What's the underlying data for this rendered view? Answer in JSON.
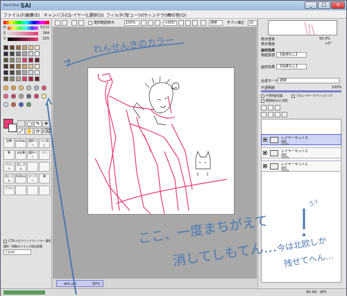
{
  "titlebar": {
    "logo_small": "PaintTool",
    "logo_main": "SAI",
    "minimize": "_",
    "maximize": "□",
    "close": "×"
  },
  "menu": [
    "ファイル(F)",
    "編集(E)",
    "キャンバス(C)",
    "レイヤー(L)",
    "選択(S)",
    "フィルタ(T)",
    "ビュー(V)",
    "ウィンドウ(W)",
    "その他(O)"
  ],
  "toolbar": {
    "selection_outline": "選択範囲表示",
    "zoom": "100%",
    "rotation": "+000°",
    "blend": "通常",
    "stabilizer_label": "手ブレ補正",
    "stabilizer_value": "10"
  },
  "color_sliders": [
    {
      "label": "H",
      "value": "5172"
    },
    {
      "label": "S",
      "value": "164"
    },
    {
      "label": "V",
      "value": "255"
    }
  ],
  "tools": {
    "brush_rows": [
      [
        "鉛筆",
        "vektaple",
        "選択ペン",
        "ペン消し"
      ],
      [
        "筆",
        "水彩筆",
        "選択ペン",
        "ペン"
      ],
      [
        "パラレル",
        "消しゴム",
        "",
        ""
      ],
      [
        "消しゴム",
        "AirBrush",
        "マーカー",
        "筆"
      ],
      [
        "ブラシ",
        "",
        "",
        ""
      ]
    ],
    "ctrl_checkbox": "CTRL+左クリックでレイヤー選択",
    "drag_threshold": "選択・移動のドラッグ検出距離",
    "brush_size": "1 pixel"
  },
  "navigator": {
    "zoom": "50.0%",
    "angle": "+0°"
  },
  "panel": {
    "zoom_label": "表示倍率",
    "angle_label": "表示角度",
    "effect_header": "画材効果",
    "texture_label": "用紙質感",
    "texture_value": "【質感なし】",
    "effect_label": "画材効果",
    "effect_value": "【効果なし】",
    "blend_label": "合成モード",
    "blend_value": "通常",
    "opacity_label": "不透明度",
    "opacity_value": "100%",
    "protect_opacity": "不透明度保護",
    "clip_layer": "下のレイヤーでクリッピング",
    "selection_source": "範囲抽出元に指定"
  },
  "layers": [
    {
      "name": "レイヤーセット3",
      "mode": "通常",
      "opacity": "100%",
      "selected": true
    },
    {
      "name": "レイヤーセット2",
      "mode": "通常",
      "opacity": "100%",
      "selected": false
    },
    {
      "name": "レイヤーセット1",
      "mode": "通常",
      "opacity": "100%",
      "selected": false
    }
  ],
  "document": {
    "name": "dim.sai",
    "zoom": "50%"
  },
  "status": {
    "memory": "SH 5H",
    "mem2": "SFS",
    "mem3": "Shift",
    "mem4": "Ctrl",
    "mem5": "Alt",
    "mem6": "SPC",
    "mem7": "Any"
  },
  "annotations": {
    "top": "れんせんきのカラー",
    "middle_line1": "ここ、一度まちがえて",
    "middle_line2": "消してしもてん…",
    "side_go": "ゴッ",
    "right_line1": "今は北欧しか",
    "right_line2": "残せてへん…"
  },
  "colors": {
    "accent_pink": "#e83a78",
    "handwriting": "#4a78b0",
    "title": "#9fbcdc"
  }
}
